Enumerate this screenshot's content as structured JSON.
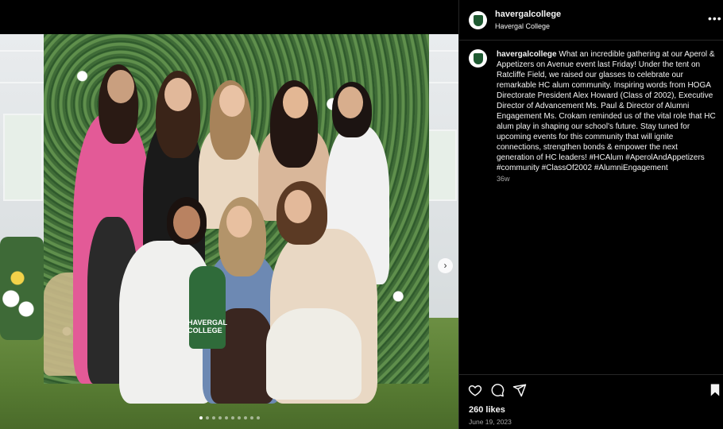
{
  "post": {
    "username": "havergalcollege",
    "subtitle": "Havergal College",
    "more_label": "•••",
    "caption_username": "havergalcollege",
    "caption_text": "What an incredible gathering at our Aperol & Appetizers on Avenue event last Friday! Under the tent on Ratcliffe Field, we raised our glasses to celebrate our remarkable HC alum community. Inspiring words from HOGA Directorate President Alex Howard (Class of 2002), Executive Director of Advancement Ms. Paul & Director of Alumni Engagement Ms. Crokam reminded us of the vital role that HC alum play in shaping our school's future. Stay tuned for upcoming events for this community that will ignite connections, strengthen bonds & empower the next generation of HC leaders! #HCAlum #AperolAndAppetizers #community #ClassOf2002 #AlumniEngagement",
    "age": "36w",
    "likes": "260 likes",
    "date": "June 19, 2023"
  },
  "media": {
    "foam_finger_text": "HAVERGAL COLLEGE",
    "carousel_next_icon": "chevron-right-icon",
    "carousel_total": 10,
    "carousel_active_index": 0
  },
  "icons": {
    "like": "heart-icon",
    "comment": "comment-icon",
    "share": "send-icon",
    "save": "bookmark-icon"
  },
  "colors": {
    "background": "#000000",
    "divider": "#262626",
    "text": "#f5f5f5",
    "muted": "#a8a8a8",
    "brand_green": "#1f5a32"
  }
}
